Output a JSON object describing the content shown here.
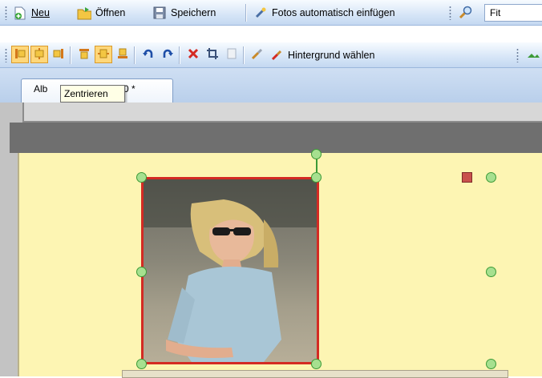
{
  "toolbar_main": {
    "new_label": "Neu",
    "open_label": "Öffnen",
    "save_label": "Speichern",
    "autofill_label": "Fotos automatisch einfügen",
    "zoom_value": "Fit"
  },
  "toolbar_layout": {
    "background_label": "Hintergrund wählen"
  },
  "tabs": {
    "active_tab_prefix": "Alb",
    "active_tab_suffix": "20 *"
  },
  "tooltip": {
    "text": "Zentrieren"
  },
  "colors": {
    "toolbar_bg": "#d6e5f7",
    "page_bg": "#fdf5b3",
    "frame_border": "#d42a23",
    "handle_fill": "#a6e08f"
  }
}
